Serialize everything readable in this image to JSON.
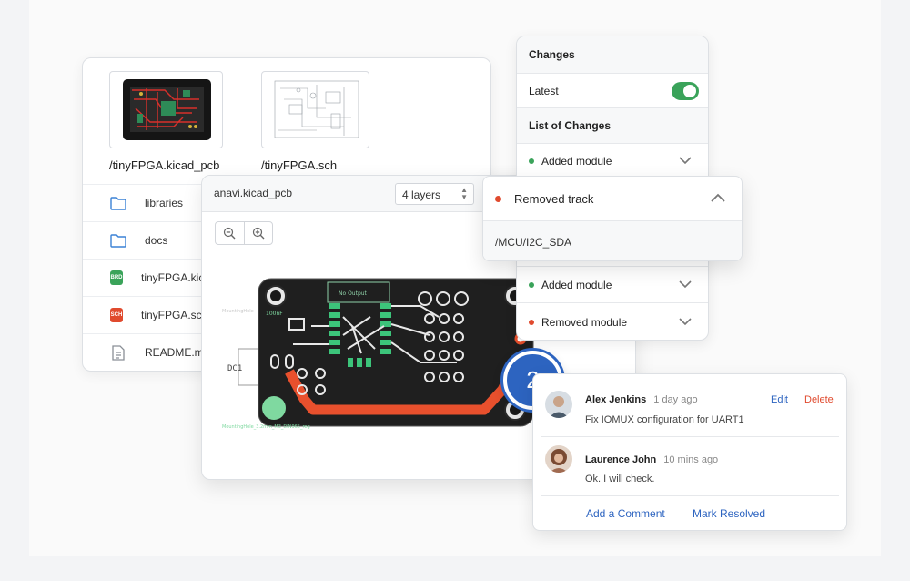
{
  "files": {
    "thumbnails": [
      {
        "label": "/tinyFPGA.kicad_pcb"
      },
      {
        "label": "/tinyFPGA.sch"
      }
    ],
    "items": [
      {
        "name": "libraries",
        "icon": "folder-icon"
      },
      {
        "name": "docs",
        "icon": "folder-icon"
      },
      {
        "name": "tinyFPGA.kic",
        "icon": "brd-file-icon",
        "badge": "BRD"
      },
      {
        "name": "tinyFPGA.sch",
        "icon": "sch-file-icon",
        "badge": "SCH"
      },
      {
        "name": "README.md",
        "icon": "document-icon"
      }
    ]
  },
  "pcb_viewer": {
    "title": "anavi.kicad_pcb",
    "layers_select": "4 layers",
    "silk_labels": {
      "dc1": "DC1",
      "mount_top": "MountingHole",
      "mount_bottom": "MountingHole_3.2mm_M3_DIN965_reg",
      "no_output": "No Output",
      "cap": "100nF"
    }
  },
  "changes": {
    "title": "Changes",
    "latest_label": "Latest",
    "latest_enabled": true,
    "list_title": "List of Changes",
    "items": [
      {
        "label": "Added module",
        "status": "added"
      },
      {
        "label": "Added module",
        "status": "added"
      },
      {
        "label": "Removed module",
        "status": "removed"
      }
    ]
  },
  "track_popup": {
    "title": "Removed track",
    "path": "/MCU/I2C_SDA"
  },
  "marker": {
    "count": "2"
  },
  "comments": {
    "items": [
      {
        "author": "Alex Jenkins",
        "time": "1 day ago",
        "text": "Fix IOMUX configuration for UART1",
        "edit": "Edit",
        "delete": "Delete"
      },
      {
        "author": "Laurence John",
        "time": "10 mins ago",
        "text": "Ok. I will check."
      }
    ],
    "add_comment": "Add a Comment",
    "mark_resolved": "Mark Resolved"
  },
  "colors": {
    "accent": "#2d64c0",
    "added": "#3aa35a",
    "removed": "#e04a2e",
    "track": "#e8502d",
    "pcb": "#1f1f1f"
  }
}
